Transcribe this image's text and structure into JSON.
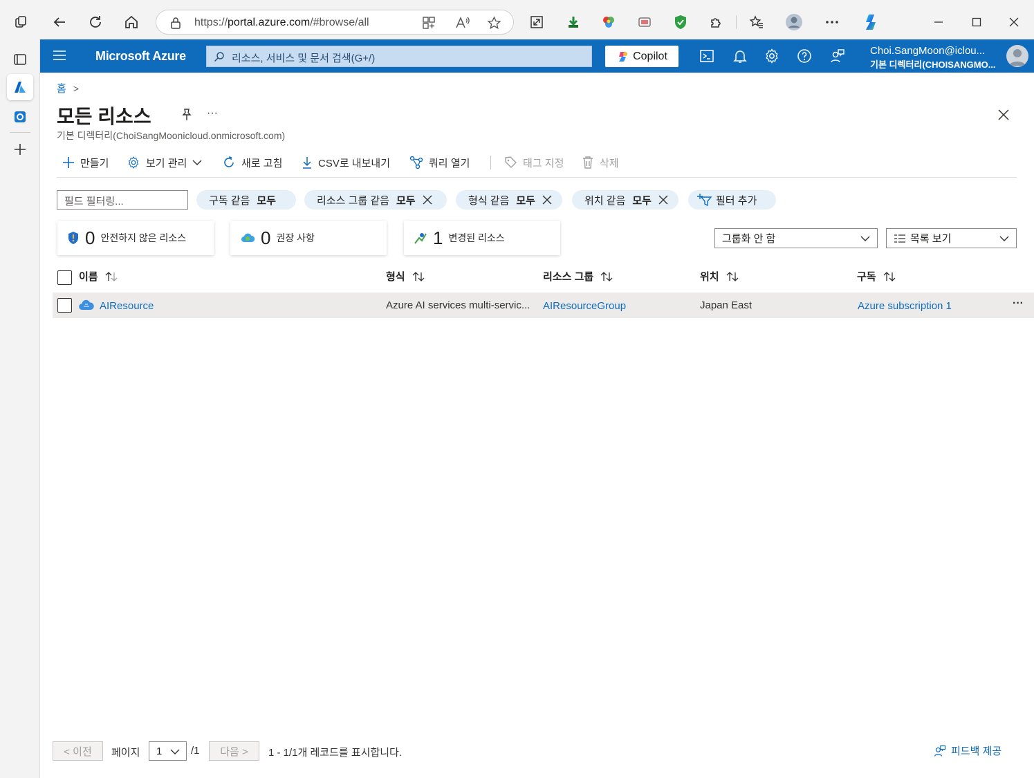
{
  "browser": {
    "url_prefix": "https://",
    "url_host": "portal.azure.com",
    "url_path": "/#browse/all"
  },
  "header": {
    "menu_icon": "hamburger-icon",
    "brand": "Microsoft Azure",
    "search_placeholder": "리소스, 서비스 및 문서 검색(G+/)",
    "copilot_label": "Copilot",
    "account_email": "Choi.SangMoon@iclou...",
    "account_directory": "기본 디렉터리(CHOISANGMO..."
  },
  "breadcrumb": {
    "home": "홈",
    "separator": ">"
  },
  "page": {
    "title": "모든 리소스",
    "subtitle": "기본 디렉터리(ChoiSangMoonicloud.onmicrosoft.com)",
    "more": "···"
  },
  "toolbar": {
    "create": "만들기",
    "manage_view": "보기 관리",
    "refresh": "새로 고침",
    "export_csv": "CSV로 내보내기",
    "open_query": "쿼리 열기",
    "assign_tags": "태그 지정",
    "delete": "삭제"
  },
  "filters": {
    "field_filter_placeholder": "필드 필터링...",
    "pills": [
      {
        "label": "구독 같음",
        "value": "모두"
      },
      {
        "label": "리소스 그룹 같음",
        "value": "모두"
      },
      {
        "label": "형식 같음",
        "value": "모두"
      },
      {
        "label": "위치 같음",
        "value": "모두"
      }
    ],
    "add_filter": "필터 추가"
  },
  "summary": {
    "unsecure": {
      "count": "0",
      "label": "안전하지 않은 리소스"
    },
    "recommendations": {
      "count": "0",
      "label": "권장 사항"
    },
    "changed": {
      "count": "1",
      "label": "변경된 리소스"
    }
  },
  "view_options": {
    "grouping": "그룹화 안 함",
    "view_mode": "목록 보기"
  },
  "table": {
    "columns": [
      "이름",
      "형식",
      "리소스 그룹",
      "위치",
      "구독"
    ],
    "rows": [
      {
        "name": "AIResource",
        "type": "Azure AI services multi-servic...",
        "resource_group": "AIResourceGroup",
        "location": "Japan East",
        "subscription": "Azure subscription 1",
        "more": "···"
      }
    ]
  },
  "pager": {
    "prev": "< 이전",
    "page_label": "페이지",
    "page_value": "1",
    "page_total": "/1",
    "next": "다음 >",
    "records": "1 - 1/1개 레코드를 표시합니다."
  },
  "feedback": "피드백 제공",
  "colors": {
    "azure_blue": "#0f6cbd",
    "pill_bg": "#e6f0f9",
    "row_selected": "#edebe9"
  }
}
